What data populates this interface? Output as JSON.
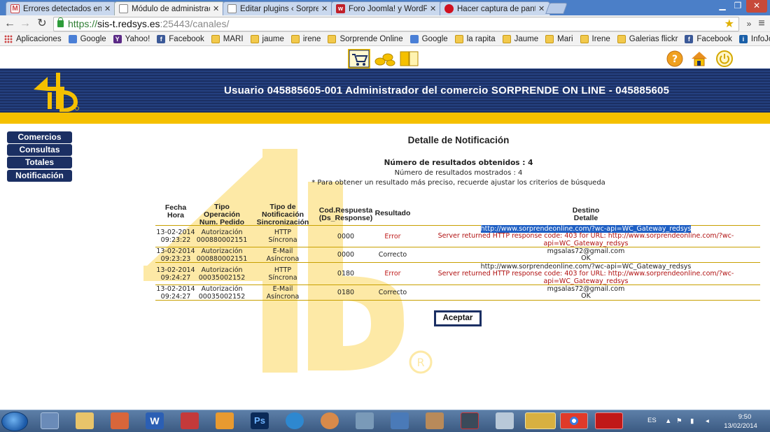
{
  "browser": {
    "tabs": [
      {
        "label": "Errores detectados en la n",
        "active": false,
        "icon": "gmail-icon"
      },
      {
        "label": "Módulo de administració",
        "active": true,
        "icon": "page-icon"
      },
      {
        "label": "Editar plugins ‹ Sorprende",
        "active": false,
        "icon": "page-icon"
      },
      {
        "label": "Foro Joomla! y WordPress",
        "active": false,
        "icon": "forum-icon"
      },
      {
        "label": "Hacer captura de pantalla",
        "active": false,
        "icon": "red-circle-icon"
      }
    ],
    "url_scheme": "https://",
    "url_host": "sis-t.redsys.es",
    "url_path": ":25443/canales/",
    "bookmarks": [
      {
        "label": "Aplicaciones",
        "icon": "apps-icon"
      },
      {
        "label": "Google",
        "icon": "google-icon"
      },
      {
        "label": "Yahoo!",
        "icon": "yahoo-icon"
      },
      {
        "label": "Facebook",
        "icon": "facebook-icon"
      },
      {
        "label": "MARI",
        "icon": "folder-icon"
      },
      {
        "label": "jaume",
        "icon": "folder-icon"
      },
      {
        "label": "irene",
        "icon": "folder-icon"
      },
      {
        "label": "Sorprende Online",
        "icon": "folder-icon"
      },
      {
        "label": "Google",
        "icon": "google-icon"
      },
      {
        "label": "la rapita",
        "icon": "folder-icon"
      },
      {
        "label": "Jaume",
        "icon": "folder-icon"
      },
      {
        "label": "Mari",
        "icon": "folder-icon"
      },
      {
        "label": "Irene",
        "icon": "folder-icon"
      },
      {
        "label": "Galerias flickr",
        "icon": "folder-icon"
      },
      {
        "label": "Facebook",
        "icon": "facebook-icon"
      },
      {
        "label": "InfoJobs",
        "icon": "infojobs-icon"
      }
    ]
  },
  "header": {
    "banner_text": "Usuario 045885605-001   Administrador del comercio   SORPRENDE ON LINE - 045885605"
  },
  "sidebar": {
    "items": [
      {
        "label": "Comercios"
      },
      {
        "label": "Consultas"
      },
      {
        "label": "Totales"
      },
      {
        "label": "Notificación"
      }
    ]
  },
  "main": {
    "title": "Detalle de Notificación",
    "results_obtained": "Número de resultados obtenidos : 4",
    "results_shown": "Número de resultados mostrados : 4",
    "hint": "* Para obtener un resultado más preciso, recuerde ajustar los criterios de búsqueda",
    "columns": [
      {
        "l1": "Fecha",
        "l2": "Hora",
        "l3": ""
      },
      {
        "l1": "Tipo",
        "l2": "Operación",
        "l3": "Num. Pedido"
      },
      {
        "l1": "Tipo de",
        "l2": "Notificación",
        "l3": "Sincronización"
      },
      {
        "l1": "Cod.Respuesta",
        "l2": "(Ds_Response)",
        "l3": ""
      },
      {
        "l1": "Resultado",
        "l2": "",
        "l3": ""
      },
      {
        "l1": "Destino",
        "l2": "Detalle",
        "l3": ""
      }
    ],
    "rows": [
      {
        "date": "13-02-2014",
        "time": "09:23:22",
        "op": "Autorización",
        "order": "000880002151",
        "notif": "HTTP",
        "sync": "Síncrona",
        "code": "0000",
        "result": "Error",
        "dest": "http://www.sorprendeonline.com/?wc-api=WC_Gateway_redsys",
        "detail1": "Server returned HTTP response code: 403 for URL: http://www.sorprendeonline.com/?wc-",
        "detail2": "api=WC_Gateway_redsys"
      },
      {
        "date": "13-02-2014",
        "time": "09:23:23",
        "op": "Autorización",
        "order": "000880002151",
        "notif": "E-Mail",
        "sync": "Asíncrona",
        "code": "0000",
        "result": "Correcto",
        "dest": "mgsalas72@gmail.com",
        "detail1": "OK",
        "detail2": ""
      },
      {
        "date": "13-02-2014",
        "time": "09:24:27",
        "op": "Autorización",
        "order": "00035002152",
        "notif": "HTTP",
        "sync": "Síncrona",
        "code": "0180",
        "result": "Error",
        "dest": "http://www.sorprendeonline.com/?wc-api=WC_Gateway_redsys",
        "detail1": "Server returned HTTP response code: 403 for URL: http://www.sorprendeonline.com/?wc-",
        "detail2": "api=WC_Gateway_redsys"
      },
      {
        "date": "13-02-2014",
        "time": "09:24:27",
        "op": "Autorización",
        "order": "00035002152",
        "notif": "E-Mail",
        "sync": "Asíncrona",
        "code": "0180",
        "result": "Correcto",
        "dest": "mgsalas72@gmail.com",
        "detail1": "OK",
        "detail2": ""
      }
    ],
    "accept_label": "Aceptar"
  },
  "taskbar": {
    "lang": "ES",
    "time": "9:50",
    "date": "13/02/2014"
  },
  "colors": {
    "navy": "#1b2f63",
    "yellow": "#f5c000",
    "error": "#b01010",
    "selection": "#1e5fc4"
  }
}
